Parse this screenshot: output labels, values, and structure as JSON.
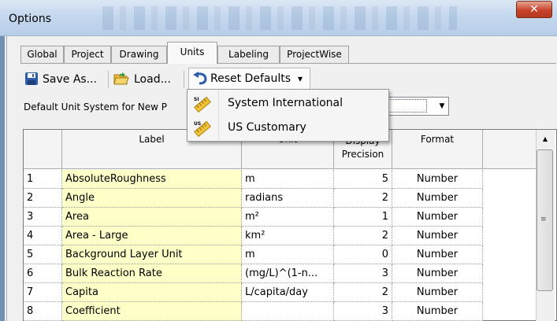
{
  "window": {
    "title": "Options",
    "close_glyph": "✕"
  },
  "tabs": [
    {
      "label": "Global"
    },
    {
      "label": "Project"
    },
    {
      "label": "Drawing"
    },
    {
      "label": "Units",
      "active": true
    },
    {
      "label": "Labeling"
    },
    {
      "label": "ProjectWise"
    }
  ],
  "toolbar": {
    "save_as": "Save As...",
    "load": "Load...",
    "reset_defaults": "Reset Defaults",
    "dropdown_glyph": "▾"
  },
  "default_unit": {
    "label": "Default Unit System for New P"
  },
  "combo": {
    "arrow": "▼"
  },
  "menu": {
    "items": [
      {
        "label": "System International",
        "icon": "si-ruler-icon",
        "icon_text": "SI"
      },
      {
        "label": "US Customary",
        "icon": "us-ruler-icon",
        "icon_text": "US"
      }
    ]
  },
  "grid": {
    "headers": {
      "label": "Label",
      "unit": "Unit",
      "precision_line1": "Display",
      "precision_line2": "Precision",
      "format": "Format"
    },
    "rows": [
      {
        "num": "1",
        "label": "AbsoluteRoughness",
        "unit": "m",
        "precision": "5",
        "format": "Number"
      },
      {
        "num": "2",
        "label": "Angle",
        "unit": "radians",
        "precision": "2",
        "format": "Number"
      },
      {
        "num": "3",
        "label": "Area",
        "unit": "m²",
        "precision": "1",
        "format": "Number"
      },
      {
        "num": "4",
        "label": "Area - Large",
        "unit": "km²",
        "precision": "2",
        "format": "Number"
      },
      {
        "num": "5",
        "label": "Background Layer Unit",
        "unit": "m",
        "precision": "0",
        "format": "Number"
      },
      {
        "num": "6",
        "label": "Bulk Reaction Rate",
        "unit": "(mg/L)^(1-n...",
        "precision": "3",
        "format": "Number"
      },
      {
        "num": "7",
        "label": "Capita",
        "unit": "L/capita/day",
        "precision": "2",
        "format": "Number"
      },
      {
        "num": "8",
        "label": "Coefficient",
        "unit": "",
        "precision": "3",
        "format": "Number"
      }
    ]
  },
  "scrollbar": {
    "up": "▲",
    "grip": "≡"
  },
  "colors": {
    "label_cell_bg": "#ffffc8",
    "title_bar": "#c5d8ee",
    "close_button": "#c8432b"
  }
}
